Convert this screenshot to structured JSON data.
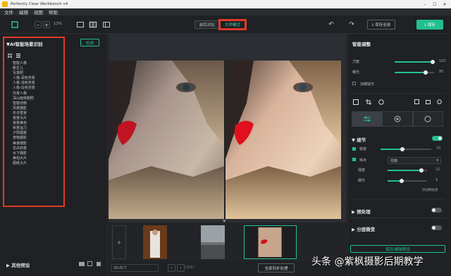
{
  "window": {
    "title": "Perfectly Clear Workbench v4"
  },
  "menu": [
    "文件",
    "编辑",
    "视图",
    "帮助"
  ],
  "toolbar": {
    "zoom": "13%",
    "modes": [
      "前后对比",
      "大师模式"
    ],
    "save_all": "保存全部",
    "save": "保存"
  },
  "left": {
    "title": "▼AI智能场景识别",
    "detect": "检测",
    "scenes": [
      "智能人像",
      "新生儿",
      "写真照",
      "人像-深色背景",
      "人像-浅色背景",
      "人像-白色背景",
      "外景人像",
      "深山雨林剧照",
      "智能动物",
      "风景摄影",
      "冬日雪景",
      "夜景大片",
      "夜景美色",
      "秋景运力",
      "夕阳烟景",
      "宠物摄影",
      "美食摄影",
      "花卉四季",
      "水下摄影",
      "美拍大片",
      "图纸大片"
    ],
    "other_presets": "▶ 其他预设"
  },
  "center": {
    "select_placeholder": "SELECT",
    "count": "(3/1)",
    "sync": "全部同步处理"
  },
  "right": {
    "title": "智能调整",
    "global": [
      {
        "label": "力度",
        "value": "100",
        "pct": 1.0
      },
      {
        "label": "曝光",
        "value": "80",
        "pct": 0.8
      }
    ],
    "deblur": "加曝疑光",
    "detail": {
      "title": "细节",
      "rows": [
        {
          "label": "锐度",
          "value": "70",
          "pct": 0.4
        },
        {
          "label": "噪点",
          "value": "",
          "pct": null
        },
        {
          "label": "强度",
          "value": "22",
          "pct": 0.75
        },
        {
          "label": "细节",
          "value": "9",
          "pct": 0.3
        }
      ],
      "noise_mode": "均衡",
      "note": "添加颗粒感"
    },
    "preprocess": "预处理",
    "layer_adjust": "分层微变",
    "save_edit": "保存/编辑预设"
  },
  "watermark": "头条 @紫枫摄影后期教学",
  "colors": {
    "accent": "#22c08e",
    "highlight": "#e03a2a"
  }
}
